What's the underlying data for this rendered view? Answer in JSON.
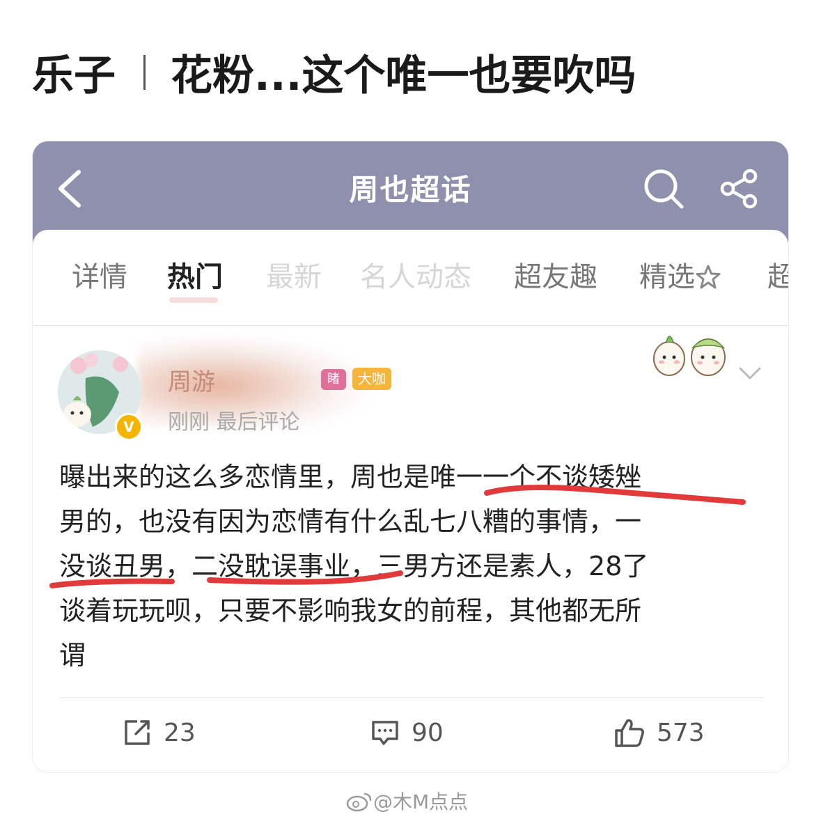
{
  "headline": {
    "left": "乐子",
    "right": "花粉...这个唯一也要吹吗"
  },
  "topic_page": {
    "title": "周也超话",
    "tabs": [
      "详情",
      "热门",
      "最新",
      "名人动态",
      "超友趣",
      "精选",
      "超"
    ],
    "active_tab": "热门"
  },
  "post": {
    "user_name": "周游",
    "badge_a": "睹",
    "badge_b": "大咖",
    "meta": "刚刚 最后评论",
    "body": {
      "s1": "曝出来的这么多恋情里，周也是",
      "s1_hl": "唯一一个不谈矮矬",
      "s2": "男的，也没有因为恋情有什么乱七八糟的事情，一",
      "s3_hl1": "没谈丑男",
      "s3_mid": "，",
      "s3_hl2": "二没耽误事业",
      "s3_end": "，三男方还是素人，28了",
      "s4": "谈着玩玩呗，只要不影响我女的前程，其他都无所",
      "s5": "谓"
    },
    "actions": {
      "reposts": "23",
      "comments": "90",
      "likes": "573"
    }
  },
  "watermark": "@木M点点",
  "colors": {
    "header_bg": "#8f90ad",
    "underline": "#e23a3a",
    "badge_pink": "#e0709a",
    "badge_gold": "#f5b53a",
    "verified": "#f5b400"
  }
}
